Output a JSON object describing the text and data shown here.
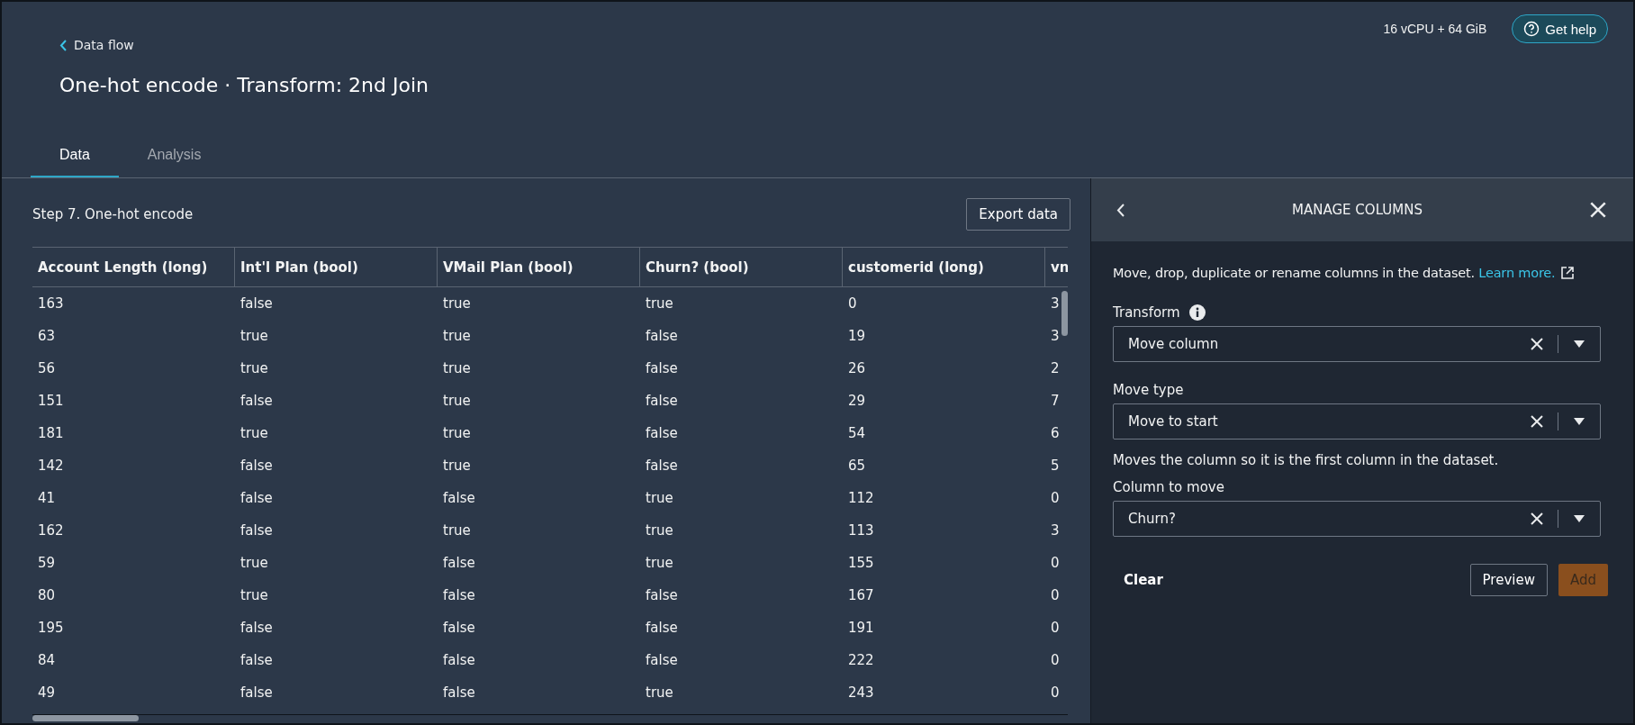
{
  "breadcrumb": "Data flow",
  "title": "One-hot encode · Transform: 2nd Join",
  "instance": "16 vCPU + 64 GiB",
  "help_button": "Get help",
  "tabs": [
    {
      "label": "Data",
      "selected": true
    },
    {
      "label": "Analysis",
      "selected": false
    }
  ],
  "step_title": "Step 7. One-hot encode",
  "export_button": "Export data",
  "table": {
    "columns": [
      "Account Length (long)",
      "Int'l Plan (bool)",
      "VMail Plan (bool)",
      "Churn? (bool)",
      "customerid (long)",
      "vn"
    ],
    "rows": [
      [
        "163",
        "false",
        "true",
        "true",
        "0",
        "3"
      ],
      [
        "63",
        "true",
        "true",
        "false",
        "19",
        "3"
      ],
      [
        "56",
        "true",
        "true",
        "false",
        "26",
        "2"
      ],
      [
        "151",
        "false",
        "true",
        "false",
        "29",
        "7"
      ],
      [
        "181",
        "true",
        "true",
        "false",
        "54",
        "6"
      ],
      [
        "142",
        "false",
        "true",
        "false",
        "65",
        "5"
      ],
      [
        "41",
        "false",
        "false",
        "true",
        "112",
        "0"
      ],
      [
        "162",
        "false",
        "true",
        "true",
        "113",
        "3"
      ],
      [
        "59",
        "true",
        "false",
        "true",
        "155",
        "0"
      ],
      [
        "80",
        "true",
        "false",
        "false",
        "167",
        "0"
      ],
      [
        "195",
        "false",
        "false",
        "false",
        "191",
        "0"
      ],
      [
        "84",
        "false",
        "false",
        "false",
        "222",
        "0"
      ],
      [
        "49",
        "false",
        "false",
        "true",
        "243",
        "0"
      ]
    ]
  },
  "panel": {
    "title": "MANAGE COLUMNS",
    "description": "Move, drop, duplicate or rename columns in the dataset.",
    "link": "Learn more.",
    "fields": [
      {
        "label": "Transform",
        "info": true,
        "value": "Move column"
      },
      {
        "label": "Move type",
        "info": false,
        "value": "Move to start",
        "hint": "Moves the column so it is the first column in the dataset."
      },
      {
        "label": "Column to move",
        "info": false,
        "value": "Churn?"
      }
    ],
    "clear_button": "Clear",
    "preview_button": "Preview",
    "add_button": {
      "label": "Add",
      "disabled": true
    }
  }
}
